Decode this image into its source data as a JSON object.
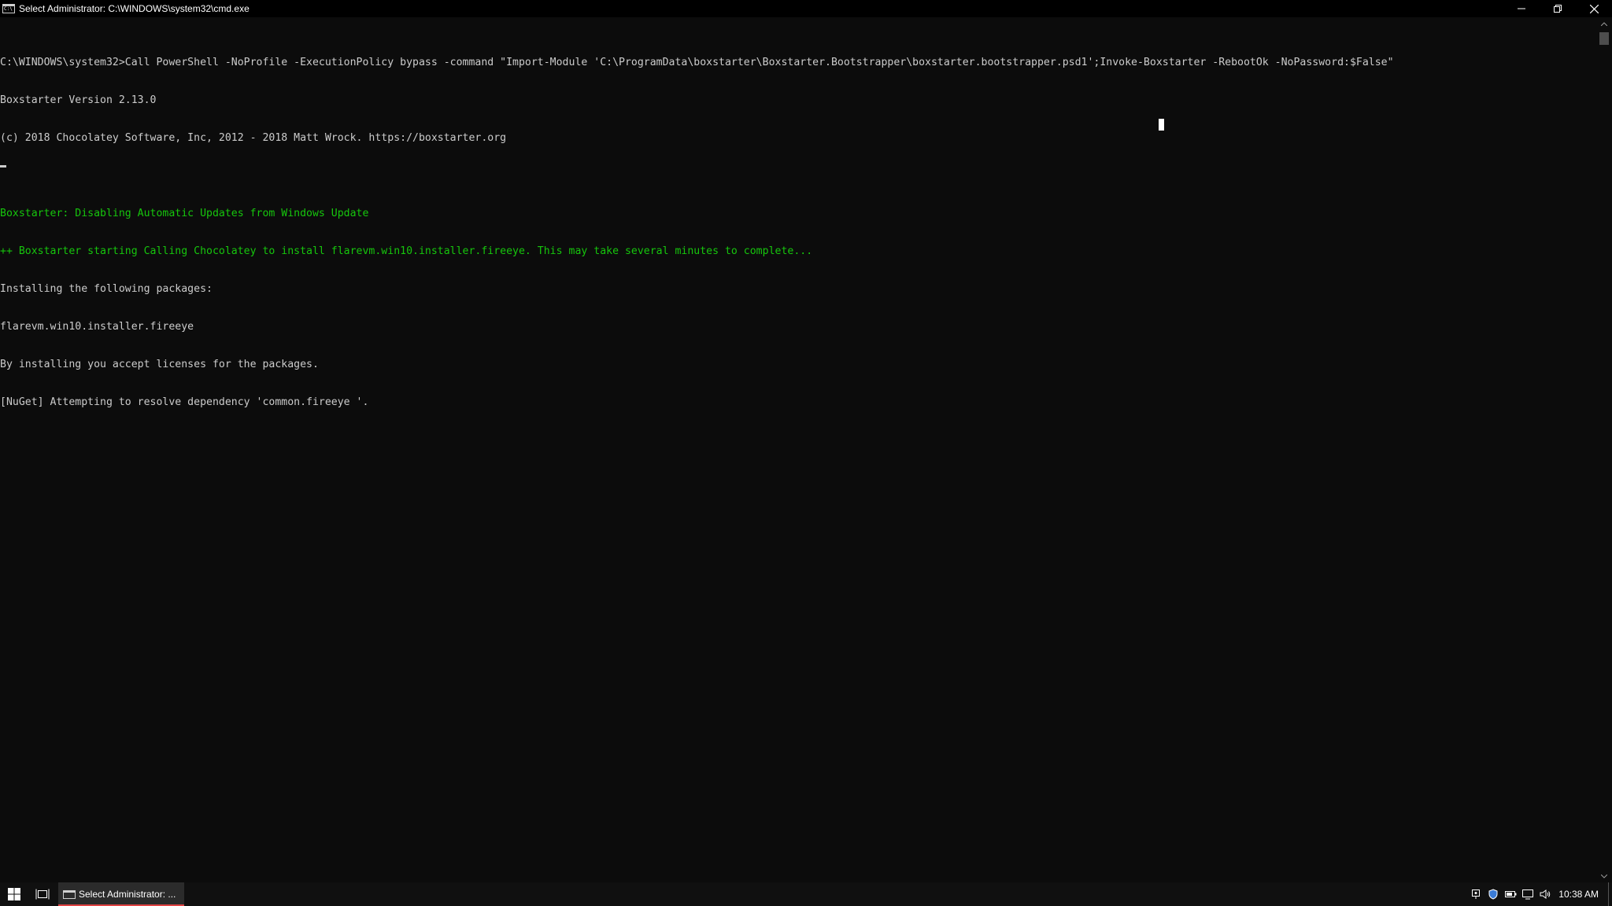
{
  "window": {
    "title": "Select Administrator: C:\\WINDOWS\\system32\\cmd.exe"
  },
  "console": {
    "lines": [
      {
        "text": "C:\\WINDOWS\\system32>Call PowerShell -NoProfile -ExecutionPolicy bypass -command \"Import-Module 'C:\\ProgramData\\boxstarter\\Boxstarter.Bootstrapper\\boxstarter.bootstrapper.psd1';Invoke-Boxstarter -RebootOk -NoPassword:$False\"",
        "color": "#cccccc"
      },
      {
        "text": "Boxstarter Version 2.13.0",
        "color": "#cccccc"
      },
      {
        "text": "(c) 2018 Chocolatey Software, Inc, 2012 - 2018 Matt Wrock. https://boxstarter.org",
        "color": "#cccccc"
      },
      {
        "text": "",
        "color": "#cccccc"
      },
      {
        "text": "Boxstarter: Disabling Automatic Updates from Windows Update",
        "color": "#16c60c"
      },
      {
        "text": "++ Boxstarter starting Calling Chocolatey to install flarevm.win10.installer.fireeye. This may take several minutes to complete...",
        "color": "#16c60c"
      },
      {
        "text": "Installing the following packages:",
        "color": "#cccccc"
      },
      {
        "text": "flarevm.win10.installer.fireeye",
        "color": "#cccccc"
      },
      {
        "text": "By installing you accept licenses for the packages.",
        "color": "#cccccc"
      },
      {
        "text": "[NuGet] Attempting to resolve dependency 'common.fireeye '.",
        "color": "#cccccc"
      }
    ]
  },
  "taskbar": {
    "app_label": "Select Administrator: ...",
    "clock": "10:38 AM",
    "tray_icons": [
      "network-adapter-icon",
      "security-shield-icon",
      "battery-icon",
      "display-icon",
      "volume-icon"
    ]
  }
}
